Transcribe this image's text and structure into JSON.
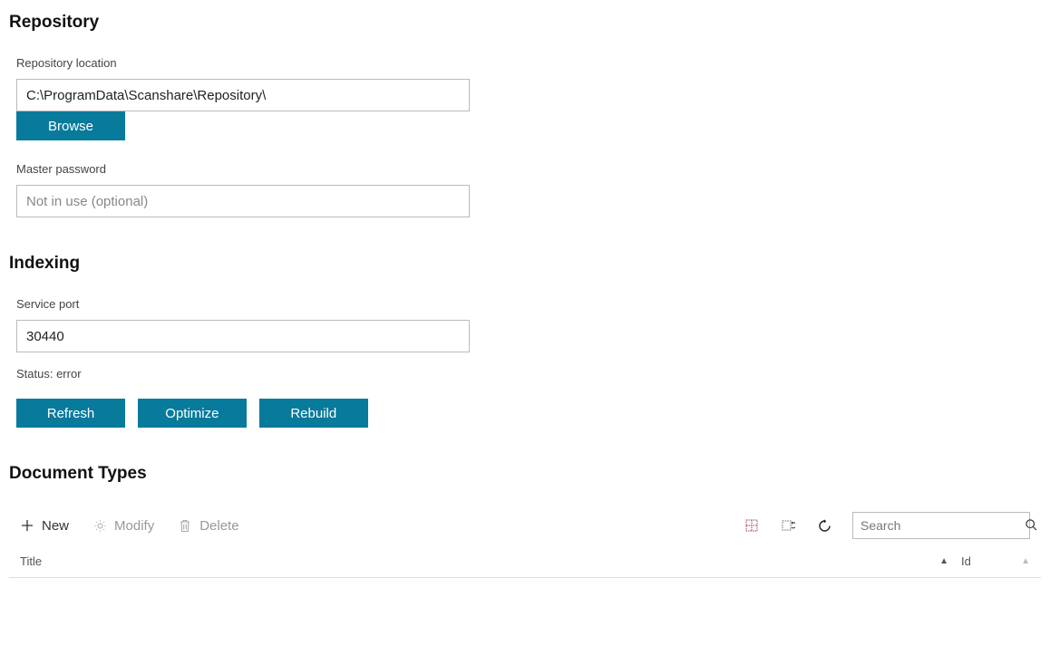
{
  "repository": {
    "title": "Repository",
    "location_label": "Repository location",
    "location_value": "C:\\ProgramData\\Scanshare\\Repository\\",
    "browse_label": "Browse",
    "master_password_label": "Master password",
    "master_password_placeholder": "Not in use (optional)",
    "master_password_value": ""
  },
  "indexing": {
    "title": "Indexing",
    "service_port_label": "Service port",
    "service_port_value": "30440",
    "status_text": "Status: error",
    "refresh_label": "Refresh",
    "optimize_label": "Optimize",
    "rebuild_label": "Rebuild"
  },
  "document_types": {
    "title": "Document Types",
    "toolbar": {
      "new_label": "New",
      "modify_label": "Modify",
      "delete_label": "Delete",
      "search_placeholder": "Search"
    },
    "columns": {
      "title_label": "Title",
      "id_label": "Id"
    }
  }
}
